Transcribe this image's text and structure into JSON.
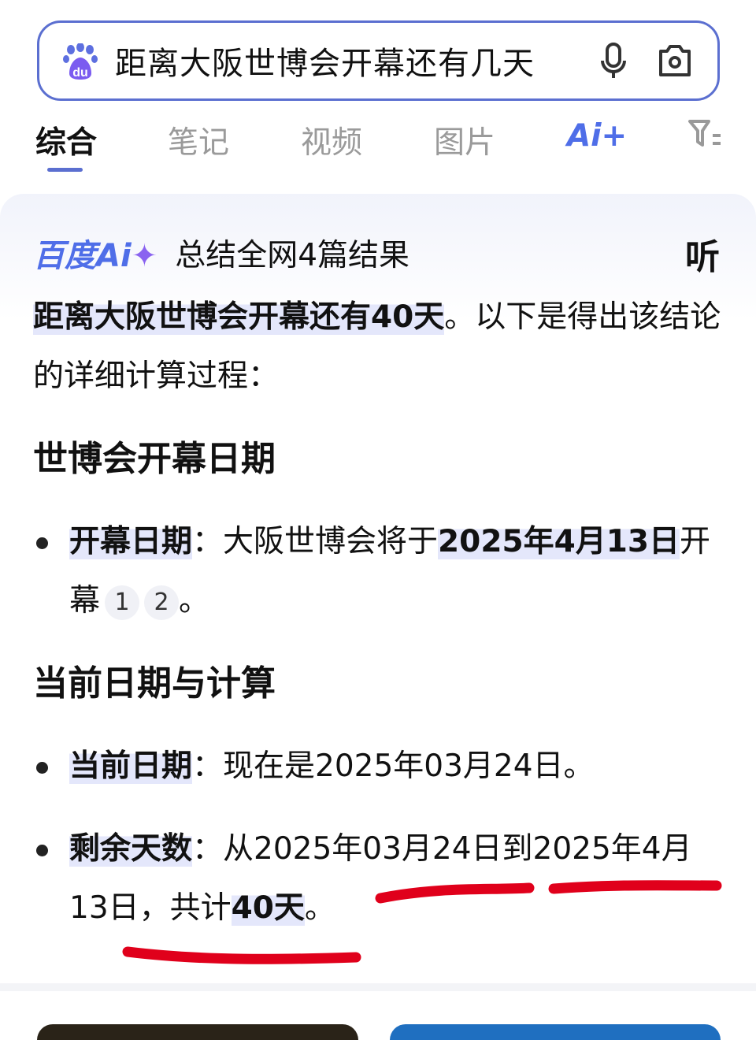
{
  "search": {
    "query": "距离大阪世博会开幕还有几天",
    "logo": "baidu-paw-logo",
    "icons": [
      "microphone-icon",
      "camera-icon"
    ]
  },
  "tabs": [
    {
      "label": "综合",
      "active": true
    },
    {
      "label": "笔记"
    },
    {
      "label": "视频"
    },
    {
      "label": "图片"
    },
    {
      "label": "Ai+"
    },
    {
      "icon": "filter-icon"
    }
  ],
  "ai": {
    "brand": "百度",
    "brand_ai": "Ai",
    "summary": "总结全网4篇结果",
    "listen": "听"
  },
  "answer": {
    "lead_bold": "距离大阪世博会开幕还有40天",
    "lead_rest": "。以下是得出该结论的详细计算过程：",
    "s1": {
      "title": "世博会开幕日期",
      "label": "开幕日期",
      "colon": "：",
      "text": "大阪世博会将于",
      "date": "2025年4月13日",
      "tail": "开幕",
      "cites": [
        "1",
        "2"
      ],
      "end": "。"
    },
    "s2": {
      "title": "当前日期与计算",
      "i1": {
        "label": "当前日期",
        "colon": "：",
        "text": "现在是2025年03月24日。"
      },
      "i2": {
        "label": "剩余天数",
        "colon": "：",
        "text": "从2025年03月24日到2025年4月13日，共计",
        "days": "40天",
        "end": "。"
      }
    }
  },
  "colors": {
    "accent": "#5b6fd0",
    "highlight": "#e4e7fb",
    "annotation": "#e0001b"
  }
}
